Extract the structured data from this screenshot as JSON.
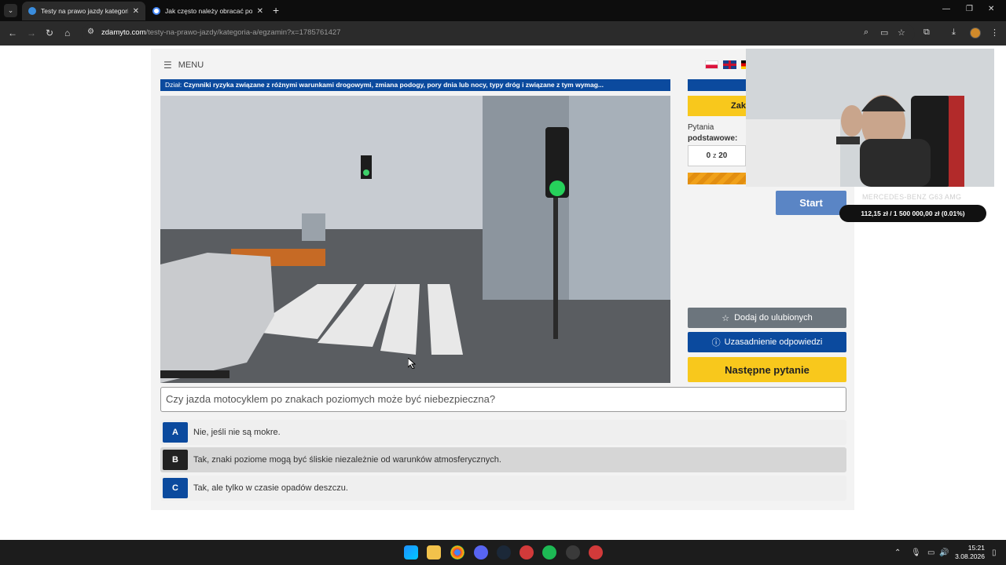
{
  "browser": {
    "tabs": [
      {
        "title": "Testy na prawo jazdy kategoria A",
        "active": true
      },
      {
        "title": "Jak często należy obracać pozi",
        "active": false
      }
    ],
    "url_host": "zdamyto.com",
    "url_path": "/testy-na-prawo-jazdy/kategoria-a/egzamin?x=1785761427"
  },
  "site": {
    "menu_label": "MENU",
    "dzial_prefix": "Dział:",
    "dzial_title": "Czynniki ryzyka związane z różnymi warunkami drogowymi, zmiana podogy, pory dnia lub nocy, typy dróg i związane z tym wymag...",
    "video_timestamp": "12:57:018",
    "side_yellow_label": "Zak",
    "pytania_label": "Pytania",
    "podstawowe_label": "podstawowe:",
    "counter_current": "0",
    "counter_sep": "z",
    "counter_total": "20",
    "fav_label": "Dodaj do ulubionych",
    "uzas_label": "Uzasadnienie odpowiedzi",
    "next_label": "Następne pytanie",
    "question": "Czy jazda motocyklem po znakach poziomych może być niebezpieczna?",
    "answers": [
      {
        "letter": "A",
        "text": "Nie, jeśli nie są mokre."
      },
      {
        "letter": "B",
        "text": "Tak, znaki poziome mogą być śliskie niezależnie od warunków atmosferycznych."
      },
      {
        "letter": "C",
        "text": "Tak, ale tylko w czasie opadów deszczu."
      }
    ]
  },
  "overlay": {
    "start_label": "Start",
    "car_title": "MERCEDES-BENZ G63 AMG",
    "donation_text": "112,15 zł / 1 500 000,00 zł (0.01%)"
  },
  "taskbar": {
    "time": "15:21",
    "date": "3.08.2026"
  },
  "colors": {
    "brand_blue": "#0b4a9e",
    "brand_yellow": "#f8c81c",
    "answer_dark": "#222222"
  },
  "icons": [
    "menu-icon",
    "star-icon",
    "question-circle-icon",
    "back-icon",
    "forward-icon",
    "reload-icon",
    "home-icon",
    "zoom-icon",
    "bookmark-star-icon",
    "extensions-icon",
    "download-icon"
  ]
}
